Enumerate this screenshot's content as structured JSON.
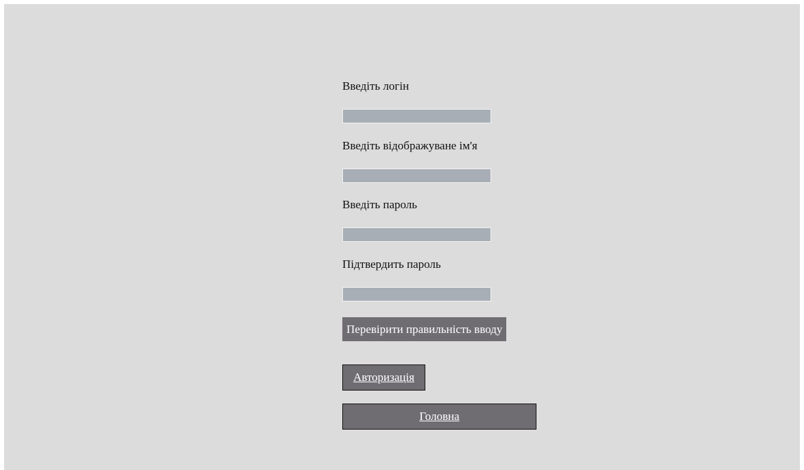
{
  "form": {
    "login_label": "Введіть логін",
    "display_name_label": "Введіть відображуване ім'я",
    "password_label": "Введіть пароль",
    "confirm_label": "Підтвердить пароль",
    "login_value": "",
    "display_name_value": "",
    "password_value": "",
    "confirm_value": "",
    "check_button": "Перевірити правильність вводу"
  },
  "links": {
    "auth": "Авторизація",
    "home": "Головна"
  },
  "colors": {
    "background": "#dcdcdc",
    "field": "#a8aeb5",
    "button": "#706d72",
    "button_text": "#ffffff"
  }
}
